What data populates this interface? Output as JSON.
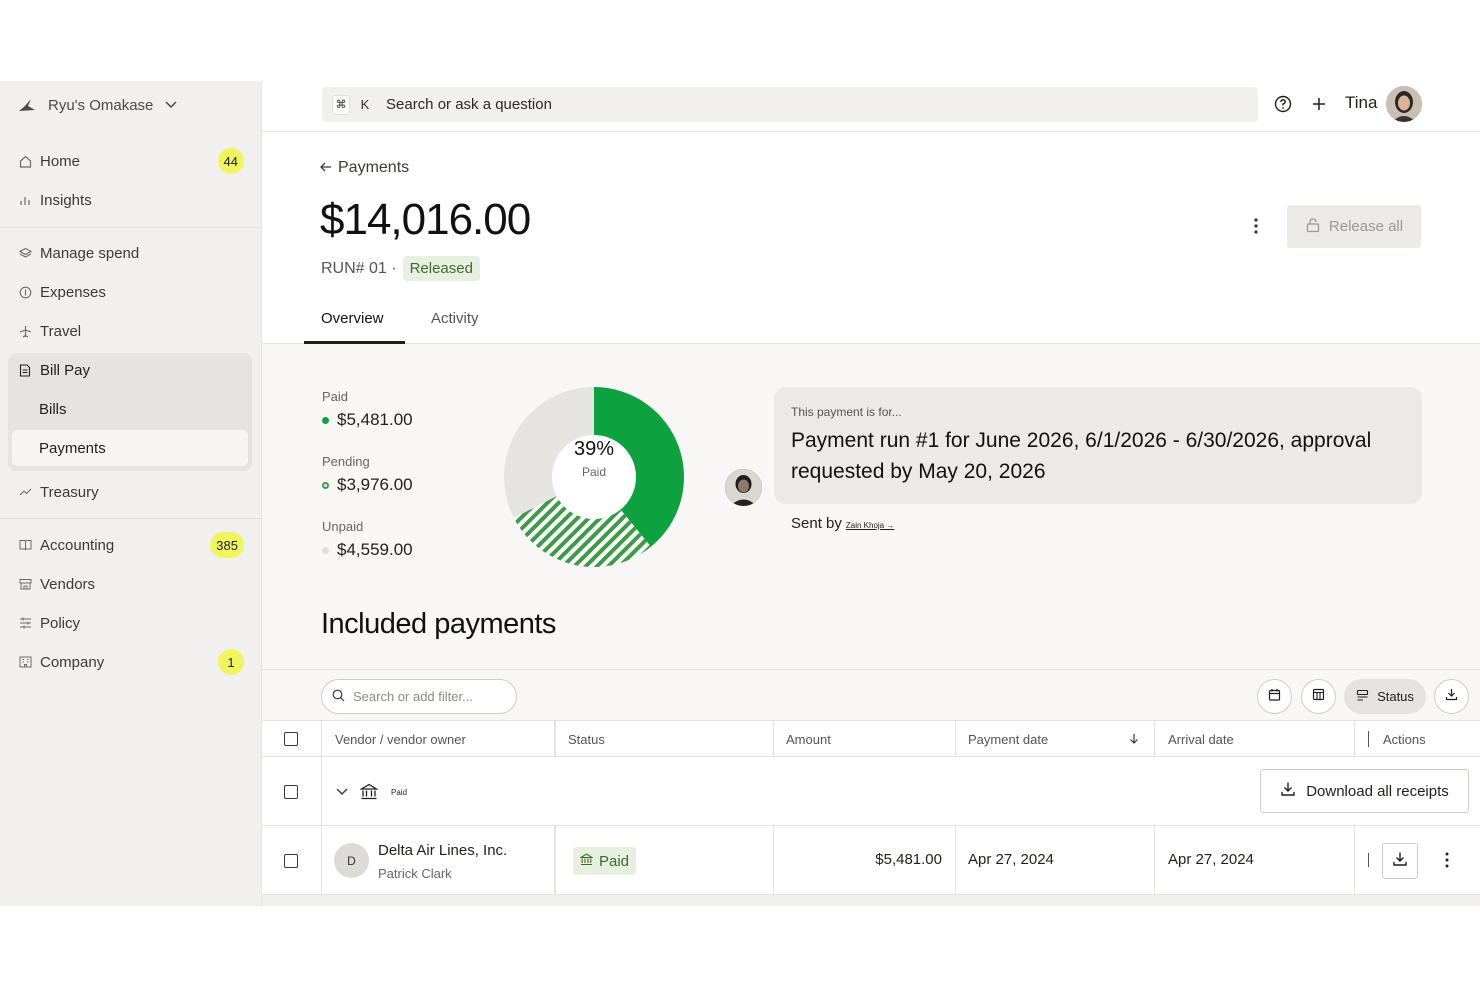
{
  "org": {
    "name": "Ryu's Omakase"
  },
  "nav": {
    "home": {
      "label": "Home",
      "badge": "44"
    },
    "insights": {
      "label": "Insights"
    },
    "manage_spend": {
      "label": "Manage spend"
    },
    "expenses": {
      "label": "Expenses"
    },
    "travel": {
      "label": "Travel"
    },
    "bill_pay": {
      "label": "Bill Pay"
    },
    "bills": {
      "label": "Bills"
    },
    "payments": {
      "label": "Payments"
    },
    "treasury": {
      "label": "Treasury"
    },
    "accounting": {
      "label": "Accounting",
      "badge": "385"
    },
    "vendors": {
      "label": "Vendors"
    },
    "policy": {
      "label": "Policy"
    },
    "company": {
      "label": "Company",
      "badge": "1"
    }
  },
  "topbar": {
    "kbd_cmd": "⌘",
    "kbd_k": "K",
    "search_placeholder": "Search or ask a question",
    "user_name": "Tina"
  },
  "header": {
    "back_label": "Payments",
    "amount": "$14,016.00",
    "run": "RUN# 01 ·",
    "status": "Released",
    "release_all": "Release all"
  },
  "tabs": {
    "overview": "Overview",
    "activity": "Activity"
  },
  "summary": {
    "paid_label": "Paid",
    "paid_value": "$5,481.00",
    "pending_label": "Pending",
    "pending_value": "$3,976.00",
    "unpaid_label": "Unpaid",
    "unpaid_value": "$4,559.00",
    "donut_pct": "39%",
    "donut_sub": "Paid",
    "donut_fractions": {
      "paid": 0.391,
      "pending": 0.284,
      "unpaid": 0.325
    },
    "colors": {
      "paid": "#0ea140",
      "pending": "#3d9a46",
      "unpaid": "#e6e4e0"
    }
  },
  "message": {
    "intro": "This payment is for...",
    "body": "Payment run #1 for June 2026, 6/1/2026 - 6/30/2026, approval requested by May 20, 2026",
    "sent_by_label": "Sent by",
    "sender": "Zain Khoja →"
  },
  "included": {
    "title": "Included payments",
    "filter_placeholder": "Search or add filter...",
    "status_btn": "Status",
    "columns": {
      "vendor": "Vendor / vendor owner",
      "status": "Status",
      "amount": "Amount",
      "payment_date": "Payment date",
      "arrival_date": "Arrival date",
      "actions": "Actions"
    },
    "group_label": "Paid",
    "download_all": "Download all receipts",
    "rows": [
      {
        "avatar": "D",
        "vendor": "Delta Air Lines, Inc.",
        "owner": "Patrick Clark",
        "status": "Paid",
        "amount": "$5,481.00",
        "payment_date": "Apr 27, 2024",
        "arrival_date": "Apr 27, 2024"
      }
    ]
  }
}
